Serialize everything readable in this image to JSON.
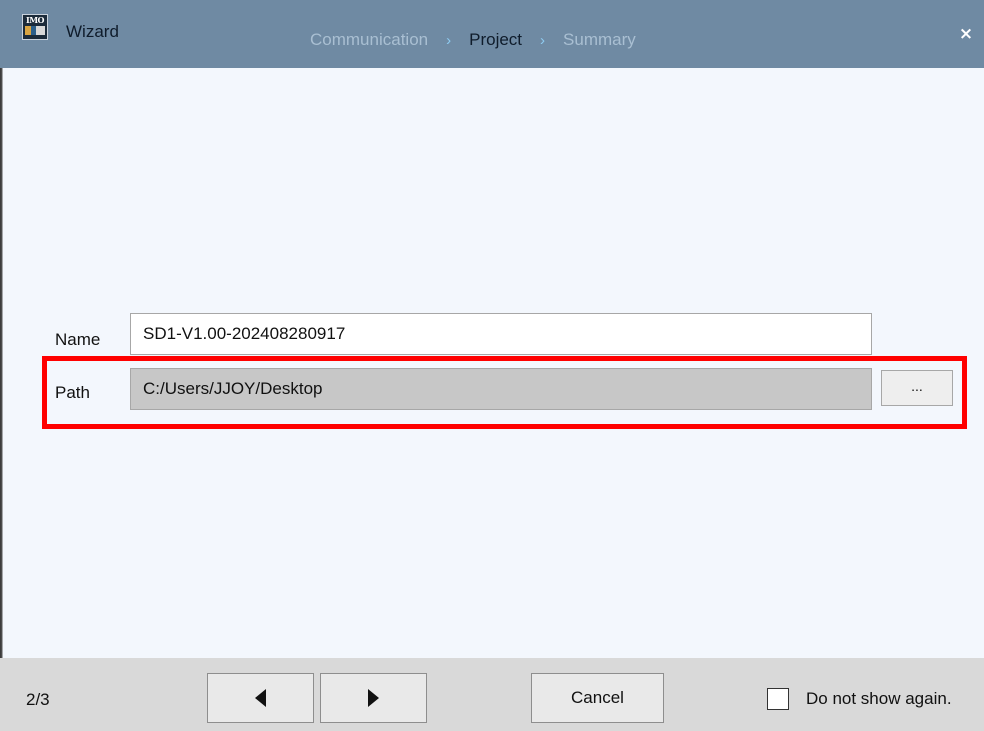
{
  "window": {
    "title": "Wizard",
    "logo_text": "IMO",
    "close_glyph": "×"
  },
  "steps": [
    {
      "label": "Communication",
      "active": false
    },
    {
      "label": "Project",
      "active": true
    },
    {
      "label": "Summary",
      "active": false
    }
  ],
  "step_separator": "›",
  "form": {
    "name_label": "Name",
    "name_value": "SD1-V1.00-202408280917",
    "path_label": "Path",
    "path_value": "C:/Users/JJOY/Desktop",
    "browse_label": "..."
  },
  "footer": {
    "page_count": "2/3",
    "cancel_label": "Cancel",
    "do_not_show_label": "Do not show again.",
    "do_not_show_checked": false
  },
  "icons": {
    "back": "triangle-left-icon",
    "next": "triangle-right-icon",
    "close": "close-icon",
    "app": "imo-logo-icon"
  },
  "colors": {
    "titlebar": "#6f8aa3",
    "content_bg": "#f3f7fd",
    "footer_bg": "#d9d9d9",
    "highlight": "#ff0000",
    "active_step": "#0f1c2b",
    "inactive_step": "#a9bfd2",
    "separator": "#8ecbf1"
  }
}
